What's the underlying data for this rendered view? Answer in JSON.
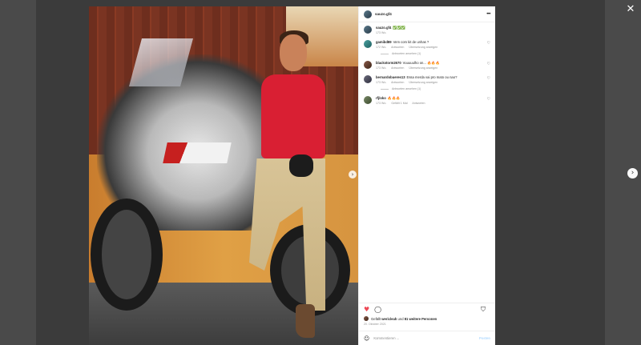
{
  "header": {
    "username": "sauzo.gf4"
  },
  "caption": {
    "username": "sauzo.gf4",
    "text": "✅✅✅",
    "time": "173 Wo."
  },
  "comments": [
    {
      "username": "gamibd89",
      "text": "Vem com kit de unhas ?",
      "time": "172 Wo.",
      "reply_label": "Antworten",
      "translate_label": "Übersetzung anzeigen",
      "replies": "Antworten ansehen (1)"
    },
    {
      "username": "blackstorm2670",
      "text": "Vuuuuulho on... 🔥🔥🔥",
      "time": "173 Wo.",
      "reply_label": "Antworten",
      "translate_label": "Übersetzung anzeigen",
      "replies": ""
    },
    {
      "username": "bernardobueres13",
      "text": "Essa merda vai pro mato ou nao?",
      "time": "173 Wo.",
      "reply_label": "Antworten",
      "translate_label": "Übersetzung anzeigen",
      "replies": "Antworten ansehen (1)"
    },
    {
      "username": "rfjloko",
      "text": "🔥🔥🔥",
      "time": "173 Wo.",
      "likes_label": "Gefällt 1 Mal",
      "reply_label": "Antworten",
      "translate_label": "",
      "replies": ""
    }
  ],
  "likes": {
    "prefix": "Gefällt",
    "user": "wericleah",
    "middle": "und",
    "others": "81 weitere Personen"
  },
  "date": "20. Oktober 2021",
  "add_comment": {
    "placeholder": "Kommentieren ...",
    "post_label": "Posten"
  },
  "icons": {
    "close": "close-icon",
    "more": "more-horizontal-icon",
    "like": "heart-icon",
    "comment": "comment-bubble-icon",
    "save": "bookmark-icon",
    "emoji": "emoji-icon",
    "next": "chevron-right-icon"
  },
  "colors": {
    "like_red": "#ed4956",
    "post_blue": "#b3dbff",
    "backdrop": "#3b3b3b"
  }
}
